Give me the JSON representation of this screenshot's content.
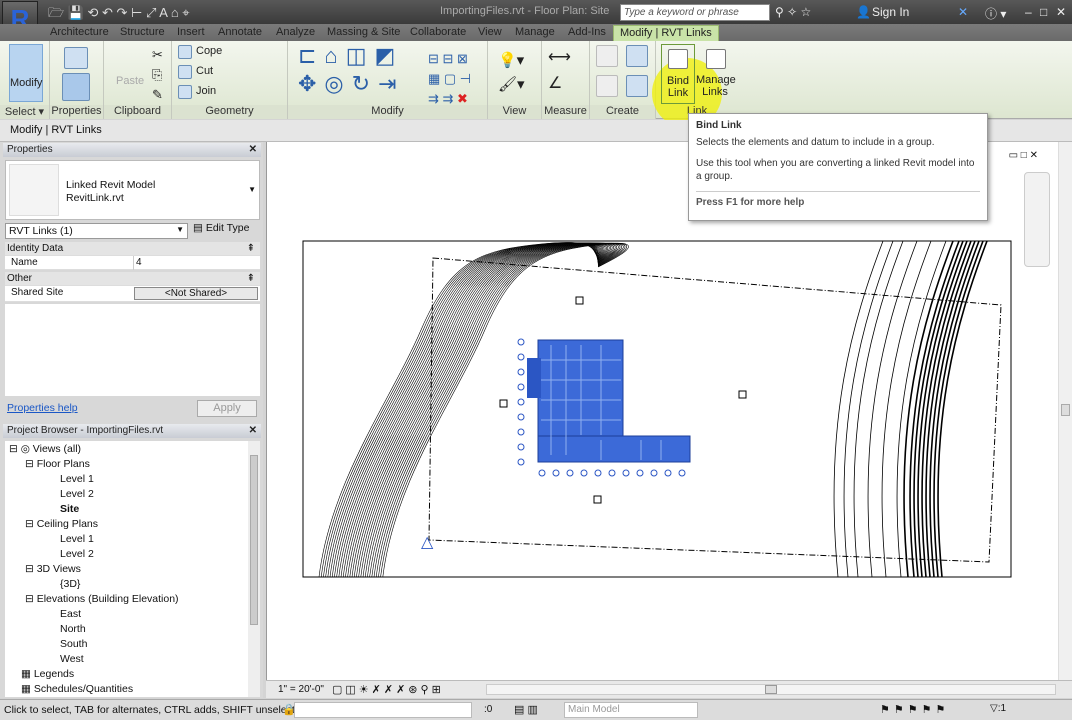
{
  "title": "ImportingFiles.rvt - Floor Plan: Site",
  "search_placeholder": "Type a keyword or phrase",
  "sign_in": "Sign In",
  "tabs": [
    "Architecture",
    "Structure",
    "Insert",
    "Annotate",
    "Analyze",
    "Massing & Site",
    "Collaborate",
    "View",
    "Manage",
    "Add-Ins",
    "Modify | RVT Links"
  ],
  "ribbon": {
    "select": {
      "modify": "Modify",
      "label": "Select ▾"
    },
    "properties": {
      "label": "Properties"
    },
    "clipboard": {
      "paste": "Paste",
      "label": "Clipboard"
    },
    "geometry": {
      "cope": "Cope",
      "cut": "Cut",
      "join": "Join",
      "label": "Geometry"
    },
    "modify": {
      "label": "Modify"
    },
    "view": {
      "label": "View"
    },
    "measure": {
      "label": "Measure"
    },
    "create": {
      "label": "Create"
    },
    "link": {
      "bind": "Bind Link",
      "manage": "Manage Links",
      "label": "Link"
    }
  },
  "options_bar": "Modify | RVT Links",
  "properties": {
    "header": "Properties",
    "type_name": "Linked Revit Model",
    "type_file": "RevitLink.rvt",
    "selector": "RVT Links (1)",
    "edit_type": "Edit Type",
    "identity_data": "Identity Data",
    "name_label": "Name",
    "name_value": "4",
    "other": "Other",
    "shared_site_label": "Shared Site",
    "shared_site_value": "<Not Shared>",
    "help": "Properties help",
    "apply": "Apply"
  },
  "browser": {
    "header": "Project Browser - ImportingFiles.rvt",
    "items": [
      "Views (all)",
      "Floor Plans",
      "Level 1",
      "Level 2",
      "Site",
      "Ceiling Plans",
      "Level 1",
      "Level 2",
      "3D Views",
      "{3D}",
      "Elevations (Building Elevation)",
      "East",
      "North",
      "South",
      "West",
      "Legends",
      "Schedules/Quantities"
    ]
  },
  "tooltip": {
    "title": "Bind Link",
    "line1": "Selects the elements and datum to include in a group.",
    "line2": "Use this tool when you are converting a linked Revit model into a group.",
    "help": "Press F1 for more help"
  },
  "view_scale": "1\" = 20'-0\"",
  "status": {
    "hint": "Click to select, TAB for alternates, CTRL adds, SHIFT unselects",
    "count": ":0",
    "model": "Main Model",
    "filter": ":1"
  }
}
